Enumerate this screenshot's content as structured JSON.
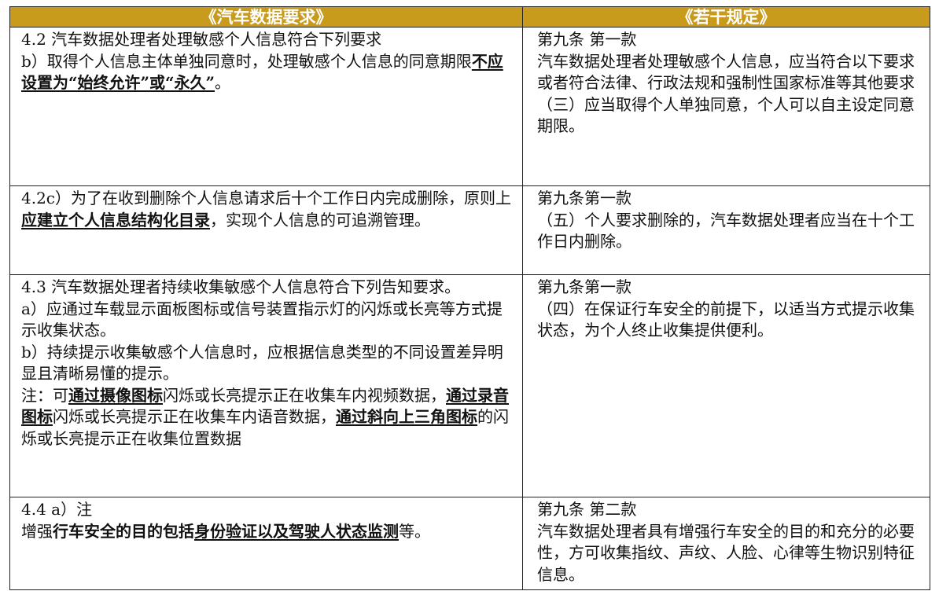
{
  "header": {
    "left": "《汽车数据要求》",
    "right": "《若干规定》"
  },
  "rows": [
    {
      "left": [
        [
          "4.2 汽车数据处理者处理敏感个人信息符合下列要求"
        ],
        [
          "b）取得个人信息主体单独同意时，处理敏感个人信息的同意期限",
          "不应设置为“始终允许”或“永久”",
          "。"
        ]
      ],
      "right": [
        "第九条 第一款",
        "汽车数据处理者处理敏感个人信息，应当符合以下要求或者符合法律、行政法规和强制性国家标准等其他要求",
        "（三）应当取得个人单独同意，个人可以自主设定同意期限。"
      ]
    },
    {
      "left": [
        [
          "4.2c）为了在收到删除个人信息请求后十个工作日内完成删除，原则上",
          "应建立个人信息结构化目录",
          "，实现个人信息的可追溯管理。"
        ]
      ],
      "right": [
        "第九条第一款",
        "（五）个人要求删除的，汽车数据处理者应当在十个工作日内删除。"
      ]
    },
    {
      "left": [
        [
          "4.3 汽车数据处理者持续收集敏感个人信息符合下列告知要求。"
        ],
        [
          "a）应通过车载显示面板图标或信号装置指示灯的闪烁或长亮等方式提示收集状态。"
        ],
        [
          "b）持续提示收集敏感个人信息时，应根据信息类型的不同设置差异明显且清晰易懂的提示。"
        ],
        [
          "注：可",
          "通过摄像图标",
          "闪烁或长亮提示正在收集车内视频数据，",
          "通过录音图标",
          "闪烁或长亮提示正在收集车内语音数据，",
          "通过斜向上三角图标",
          "的闪烁或长亮提示正在收集位置数据"
        ]
      ],
      "right": [
        "第九条第一款",
        "（四）在保证行车安全的前提下，以适当方式提示收集状态，为个人终止收集提供便利。"
      ]
    },
    {
      "left_line1": "4.4 a）注",
      "left_line2": {
        "p1": "增强",
        "p2": "行车安全的目的包括",
        "p3": "身份验证以及驾驶人状态监测",
        "p4": "等。"
      },
      "right": [
        "第九条 第二款",
        "汽车数据处理者具有增强行车安全的目的和充分的必要性，方可收集指纹、声纹、人脸、心律等生物识别特征信息。"
      ]
    }
  ]
}
